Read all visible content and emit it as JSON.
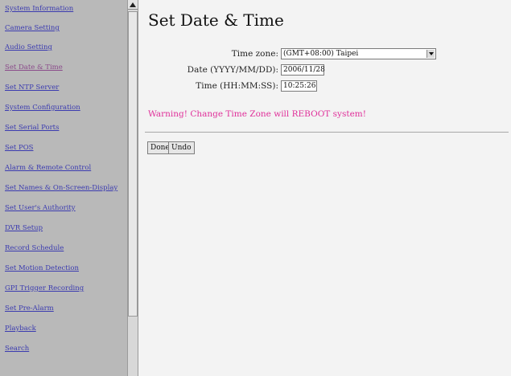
{
  "sidebar": {
    "items": [
      {
        "label": "System Information",
        "visited": false
      },
      {
        "label": "Camera Setting",
        "visited": false
      },
      {
        "label": "Audio Setting",
        "visited": false
      },
      {
        "label": "Set Date & Time",
        "visited": true
      },
      {
        "label": "Set NTP Server",
        "visited": false
      },
      {
        "label": "System Configuration",
        "visited": false
      },
      {
        "label": "Set Serial Ports",
        "visited": false
      },
      {
        "label": "Set POS",
        "visited": false
      },
      {
        "label": "Alarm & Remote Control",
        "visited": false
      },
      {
        "label": "Set Names & On-Screen-Display",
        "visited": false
      },
      {
        "label": "Set User's Authority",
        "visited": false
      },
      {
        "label": "DVR Setup",
        "visited": false
      },
      {
        "label": "Record Schedule",
        "visited": false
      },
      {
        "label": "Set Motion Detection",
        "visited": false
      },
      {
        "label": "GPI Trigger Recording",
        "visited": false
      },
      {
        "label": "Set Pre-Alarm",
        "visited": false
      },
      {
        "label": "Playback",
        "visited": false
      },
      {
        "label": "Search",
        "visited": false
      }
    ]
  },
  "main": {
    "title": "Set Date & Time",
    "timezone": {
      "label": "Time zone:",
      "value": "(GMT+08:00) Taipei"
    },
    "date": {
      "label": "Date (YYYY/MM/DD):",
      "value": "2006/11/28"
    },
    "time": {
      "label": "Time (HH:MM:SS):",
      "value": "10:25:26"
    },
    "warning": "Warning! Change Time Zone will REBOOT system!",
    "buttons": {
      "done": "Done",
      "undo": "Undo"
    }
  },
  "colors": {
    "link": "#3b3bb0",
    "visited_link": "#8a4a8a",
    "warning": "#e0309a",
    "sidebar_bg": "#b9b9b9"
  }
}
